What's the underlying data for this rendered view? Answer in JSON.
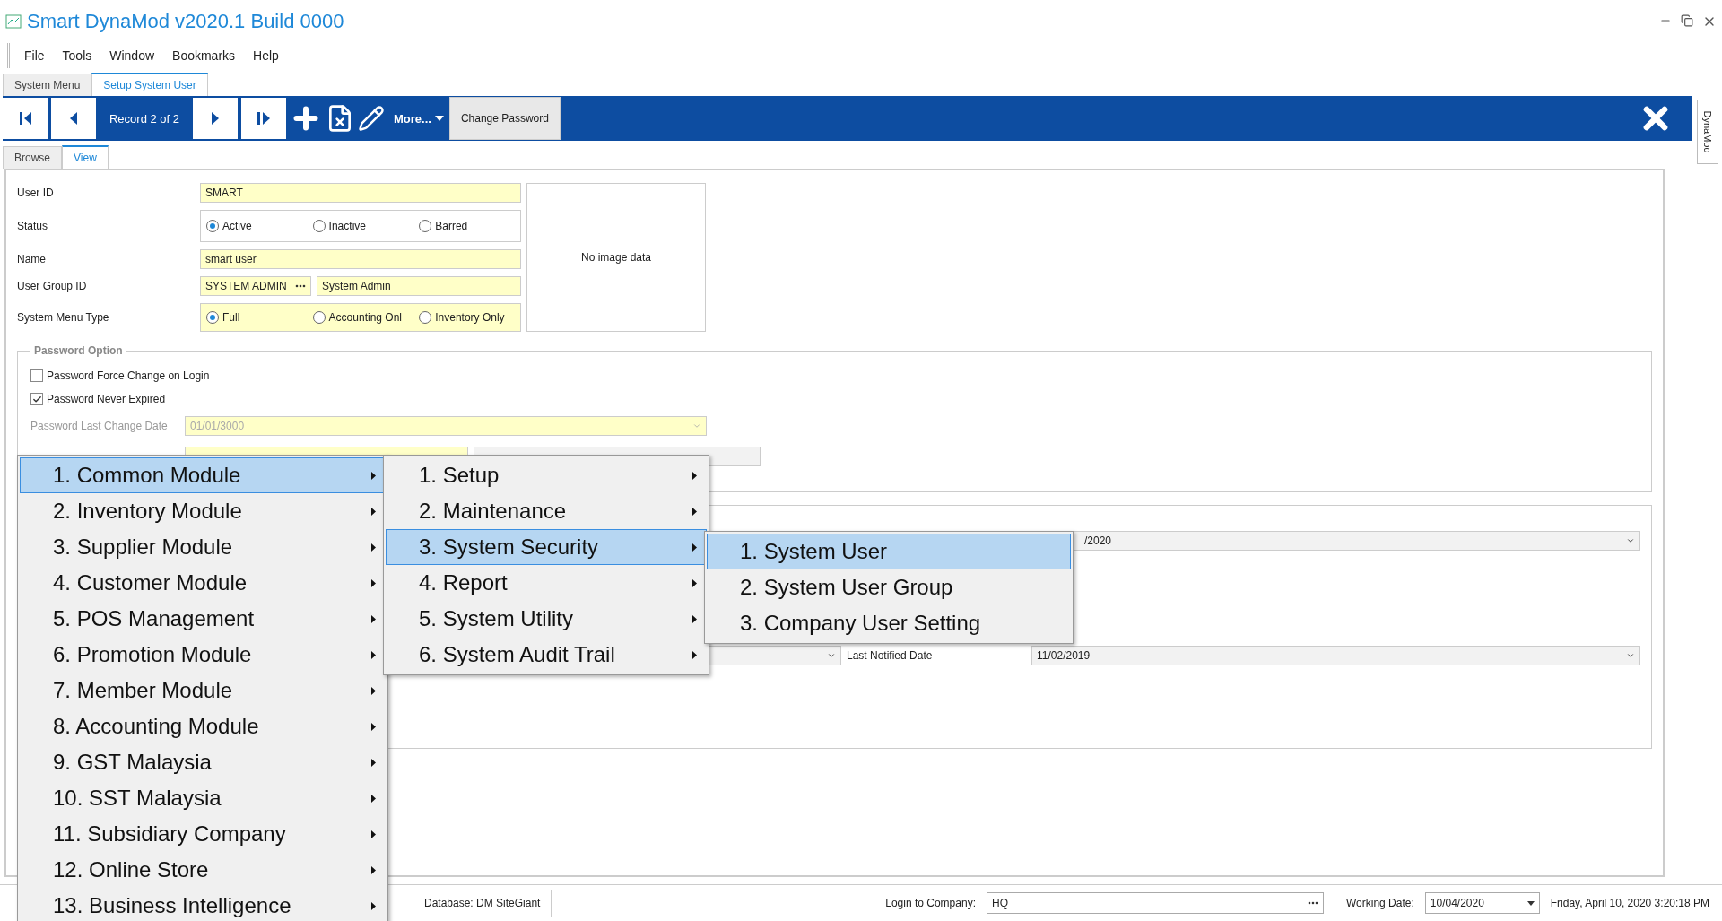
{
  "window": {
    "title": "Smart DynaMod v2020.1 Build 0000"
  },
  "menu_bar": [
    "File",
    "Tools",
    "Window",
    "Bookmarks",
    "Help"
  ],
  "document_tabs": [
    {
      "label": "System Menu",
      "selected": false
    },
    {
      "label": "Setup System User",
      "selected": true
    }
  ],
  "toolbar": {
    "record": "Record 2 of 2",
    "more": "More...",
    "change_password": "Change Password"
  },
  "side_tab": "DynaMod",
  "view_tabs": [
    {
      "label": "Browse",
      "selected": false
    },
    {
      "label": "View",
      "selected": true
    }
  ],
  "form": {
    "user_id": {
      "label": "User ID",
      "value": "SMART"
    },
    "status": {
      "label": "Status",
      "options": [
        {
          "label": "Active",
          "selected": true
        },
        {
          "label": "Inactive",
          "selected": false
        },
        {
          "label": "Barred",
          "selected": false
        }
      ]
    },
    "name": {
      "label": "Name",
      "value": "smart user"
    },
    "user_group": {
      "label": "User Group ID",
      "code": "SYSTEM ADMIN",
      "description": "System Admin"
    },
    "menu_type": {
      "label": "System Menu Type",
      "options": [
        {
          "label": "Full",
          "selected": true
        },
        {
          "label": "Accounting Onl",
          "selected": false
        },
        {
          "label": "Inventory Only",
          "selected": false
        }
      ]
    },
    "image": "No image data"
  },
  "password_option": {
    "title": "Password Option",
    "checkboxes": [
      {
        "label": "Password Force Change on Login",
        "checked": false
      },
      {
        "label": "Password Never Expired",
        "checked": true
      }
    ],
    "last_change": {
      "label": "Password Last Change Date",
      "value": "01/01/3000"
    }
  },
  "notify": {
    "date_1": "/2020",
    "last_notified": {
      "label": "Last Notified Date",
      "value": "11/02/2019"
    }
  },
  "context_menus": [
    {
      "submenus": true,
      "items": [
        {
          "label": "1. Common Module",
          "selected": true
        },
        {
          "label": "2. Inventory Module",
          "selected": false
        },
        {
          "label": "3. Supplier Module",
          "selected": false
        },
        {
          "label": "4. Customer Module",
          "selected": false
        },
        {
          "label": "5. POS Management",
          "selected": false
        },
        {
          "label": "6. Promotion Module",
          "selected": false
        },
        {
          "label": "7. Member Module",
          "selected": false
        },
        {
          "label": "8. Accounting Module",
          "selected": false
        },
        {
          "label": "9. GST Malaysia",
          "selected": false
        },
        {
          "label": "10. SST Malaysia",
          "selected": false
        },
        {
          "label": "11. Subsidiary Company",
          "selected": false
        },
        {
          "label": "12. Online Store",
          "selected": false
        },
        {
          "label": "13. Business Intelligence",
          "selected": false
        }
      ]
    },
    {
      "submenus": true,
      "items": [
        {
          "label": "1. Setup",
          "selected": false
        },
        {
          "label": "2. Maintenance",
          "selected": false
        },
        {
          "label": "3. System Security",
          "selected": true
        },
        {
          "label": "4. Report",
          "selected": false
        },
        {
          "label": "5. System Utility",
          "selected": false
        },
        {
          "label": "6. System Audit Trail",
          "selected": false
        }
      ]
    },
    {
      "submenus": false,
      "items": [
        {
          "label": "1. System User",
          "selected": true
        },
        {
          "label": "2. System User Group",
          "selected": false
        },
        {
          "label": "3. Company User Setting",
          "selected": false
        }
      ]
    }
  ],
  "status_bar": {
    "database": "Database: DM SiteGiant",
    "login_label": "Login to Company:",
    "company": "HQ",
    "working_date_label": "Working Date:",
    "working_date": "10/04/2020",
    "datetime": "Friday, April 10, 2020 3:20:18 PM"
  }
}
